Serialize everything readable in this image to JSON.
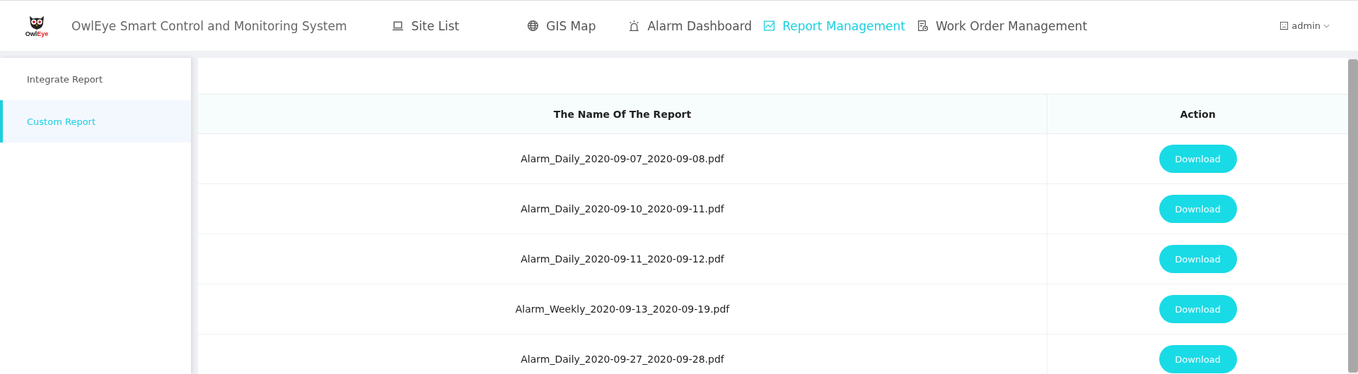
{
  "header": {
    "logo": {
      "part_1": "Owl",
      "part_2": "Eye"
    },
    "title": "OwlEye Smart Control and Monitoring System",
    "nav": [
      {
        "label": "Site List",
        "kind": "laptop",
        "selected": false
      },
      {
        "label": "GIS Map",
        "kind": "globe",
        "selected": false
      },
      {
        "label": "Alarm Dashboard",
        "kind": "alarm",
        "selected": false
      },
      {
        "label": "Report Management",
        "kind": "chart",
        "selected": true
      },
      {
        "label": "Work Order Management",
        "kind": "order",
        "selected": false
      }
    ],
    "user": "admin"
  },
  "sidebar": {
    "items": [
      {
        "label": "Integrate Report",
        "selected": false
      },
      {
        "label": "Custom Report",
        "selected": true
      }
    ]
  },
  "table": {
    "columns": [
      "The Name Of The Report",
      "Action"
    ],
    "rows": [
      {
        "name": "Alarm_Daily_2020-09-07_2020-09-08.pdf",
        "action": "Download"
      },
      {
        "name": "Alarm_Daily_2020-09-10_2020-09-11.pdf",
        "action": "Download"
      },
      {
        "name": "Alarm_Daily_2020-09-11_2020-09-12.pdf",
        "action": "Download"
      },
      {
        "name": "Alarm_Weekly_2020-09-13_2020-09-19.pdf",
        "action": "Download"
      },
      {
        "name": "Alarm_Daily_2020-09-27_2020-09-28.pdf",
        "action": "Download"
      }
    ]
  }
}
